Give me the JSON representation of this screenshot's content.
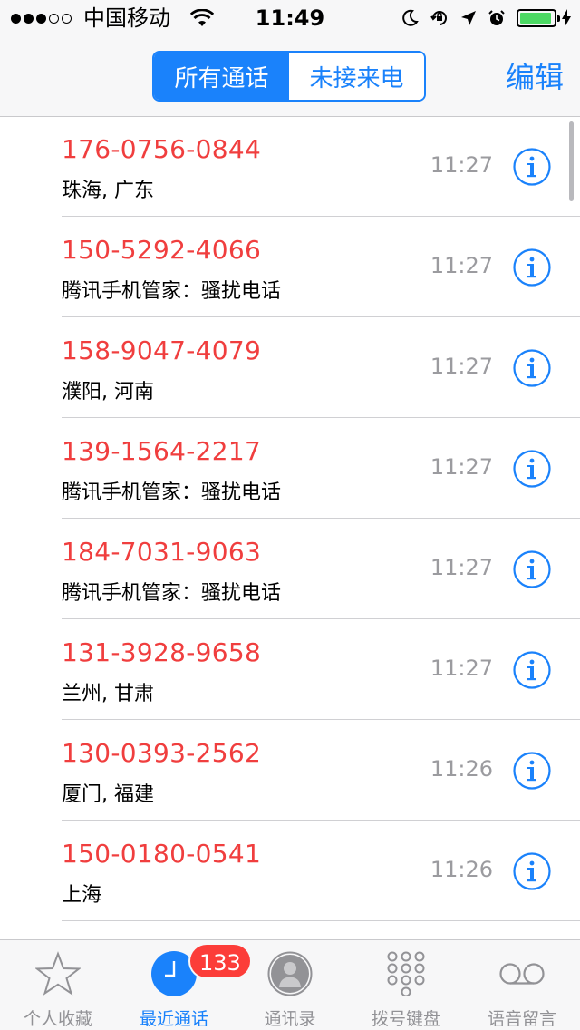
{
  "status_bar": {
    "signal_bars_filled": 3,
    "signal_bars_total": 5,
    "carrier": "中国移动",
    "time": "11:49",
    "battery_level": 0.95,
    "icons": [
      "moon-icon",
      "rotation-lock-icon",
      "location-arrow-icon",
      "alarm-icon",
      "battery-icon",
      "charging-bolt-icon"
    ]
  },
  "nav": {
    "segments": [
      {
        "label": "所有通话",
        "active": true
      },
      {
        "label": "未接来电",
        "active": false
      }
    ],
    "edit_label": "编辑"
  },
  "calls": [
    {
      "number": "176-0756-0844",
      "location": "珠海, 广东",
      "time": "11:27"
    },
    {
      "number": "150-5292-4066",
      "location": "腾讯手机管家：骚扰电话",
      "time": "11:27"
    },
    {
      "number": "158-9047-4079",
      "location": "濮阳, 河南",
      "time": "11:27"
    },
    {
      "number": "139-1564-2217",
      "location": "腾讯手机管家：骚扰电话",
      "time": "11:27"
    },
    {
      "number": "184-7031-9063",
      "location": "腾讯手机管家：骚扰电话",
      "time": "11:27"
    },
    {
      "number": "131-3928-9658",
      "location": "兰州, 甘肃",
      "time": "11:27"
    },
    {
      "number": "130-0393-2562",
      "location": "厦门, 福建",
      "time": "11:26"
    },
    {
      "number": "150-0180-0541",
      "location": "上海",
      "time": "11:26"
    }
  ],
  "tabbar": {
    "tabs": [
      {
        "label": "个人收藏",
        "icon": "star-icon"
      },
      {
        "label": "最近通话",
        "icon": "clock-icon",
        "active": true
      },
      {
        "label": "通讯录",
        "icon": "contact-icon"
      },
      {
        "label": "拨号键盘",
        "icon": "keypad-icon"
      },
      {
        "label": "语音留言",
        "icon": "voicemail-icon"
      }
    ],
    "badge": "133"
  },
  "colors": {
    "accent": "#1a82fb",
    "missed_call": "#f03e3e",
    "badge": "#fc3d39",
    "battery": "#4cd964"
  }
}
